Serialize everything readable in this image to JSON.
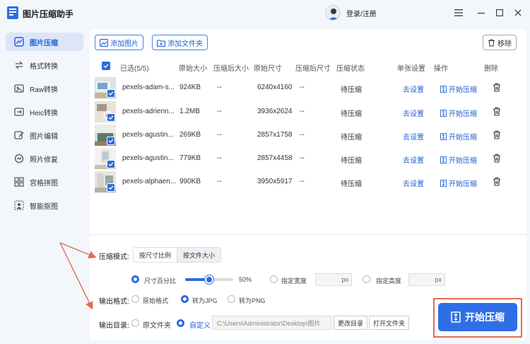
{
  "app": {
    "title": "图片压缩助手",
    "login": "登录/注册"
  },
  "window": {
    "menu_icon": "menu-icon",
    "minimize_icon": "minimize-icon",
    "maximize_icon": "maximize-icon",
    "close_icon": "close-icon"
  },
  "sidebar": {
    "items": [
      {
        "label": "图片压缩",
        "icon": "compress-icon",
        "active": true
      },
      {
        "label": "格式转换",
        "icon": "convert-icon",
        "active": false
      },
      {
        "label": "Raw转换",
        "icon": "raw-icon",
        "active": false
      },
      {
        "label": "Heic转换",
        "icon": "heic-icon",
        "active": false
      },
      {
        "label": "图片编辑",
        "icon": "edit-icon",
        "active": false
      },
      {
        "label": "照片修复",
        "icon": "repair-icon",
        "active": false
      },
      {
        "label": "宫格拼图",
        "icon": "grid-icon",
        "active": false
      },
      {
        "label": "智能抠图",
        "icon": "cutout-icon",
        "active": false
      }
    ]
  },
  "toolbar": {
    "add_image": "添加图片",
    "add_folder": "添加文件夹",
    "remove": "移除"
  },
  "table": {
    "headers": {
      "selected": "已选(5/5)",
      "orig_size": "原始大小",
      "comp_size": "压缩后大小",
      "orig_dim": "原始尺寸",
      "comp_dim": "压缩后尺寸",
      "status": "压缩状态",
      "settings": "单张设置",
      "action": "操作",
      "delete": "删除"
    },
    "rows": [
      {
        "name": "pexels-adam-s...",
        "orig_size": "924KB",
        "comp_size": "--",
        "orig_dim": "6240x4160",
        "comp_dim": "--",
        "status": "待压缩",
        "settings": "去设置",
        "action": "开始压缩"
      },
      {
        "name": "pexels-adrienn...",
        "orig_size": "1.2MB",
        "comp_size": "--",
        "orig_dim": "3936x2624",
        "comp_dim": "--",
        "status": "待压缩",
        "settings": "去设置",
        "action": "开始压缩"
      },
      {
        "name": "pexels-agustin...",
        "orig_size": "269KB",
        "comp_size": "--",
        "orig_dim": "2857x1758",
        "comp_dim": "--",
        "status": "待压缩",
        "settings": "去设置",
        "action": "开始压缩"
      },
      {
        "name": "pexels-agustin...",
        "orig_size": "779KB",
        "comp_size": "--",
        "orig_dim": "2857x4458",
        "comp_dim": "--",
        "status": "待压缩",
        "settings": "去设置",
        "action": "开始压缩"
      },
      {
        "name": "pexels-alphaen...",
        "orig_size": "990KB",
        "comp_size": "--",
        "orig_dim": "3950x5917",
        "comp_dim": "--",
        "status": "待压缩",
        "settings": "去设置",
        "action": "开始压缩"
      }
    ]
  },
  "compress": {
    "mode_label": "压缩模式:",
    "mode_tabs": [
      "按尺寸比例",
      "按文件大小"
    ],
    "percent_label": "尺寸百分比",
    "percent_value": "50%",
    "percent_level": 0.5,
    "width_label": "指定宽度",
    "height_label": "指定高度",
    "px": "px",
    "format_label": "输出格式:",
    "formats": [
      "原始格式",
      "转为JPG",
      "转为PNG"
    ],
    "dir_label": "输出目录:",
    "dir_options": [
      "原文件夹",
      "自定义"
    ],
    "dir_path": "C:\\Users\\Administrator\\Desktop\\图片",
    "change_dir": "更改目录",
    "open_folder": "打开文件夹",
    "start": "开始压缩"
  },
  "colors": {
    "accent": "#2f6fe6",
    "annotation": "#e06c54"
  }
}
